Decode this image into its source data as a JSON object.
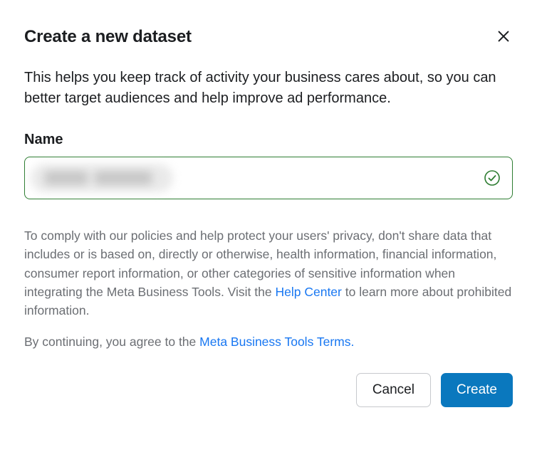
{
  "dialog": {
    "title": "Create a new dataset",
    "description": "This helps you keep track of activity your business cares about, so you can better target audiences and help improve ad performance."
  },
  "form": {
    "name_label": "Name",
    "name_value": ""
  },
  "policy": {
    "text_before_link": "To comply with our policies and help protect your users' privacy, don't share data that includes or is based on, directly or otherwise, health information, financial information, consumer report information, or other categories of sensitive information when integrating the Meta Business Tools. Visit the ",
    "help_center_link": "Help Center",
    "text_after_link": " to learn more about prohibited information."
  },
  "terms": {
    "text_before_link": "By continuing, you agree to the ",
    "tools_terms_link": "Meta Business Tools Terms."
  },
  "buttons": {
    "cancel": "Cancel",
    "create": "Create"
  }
}
